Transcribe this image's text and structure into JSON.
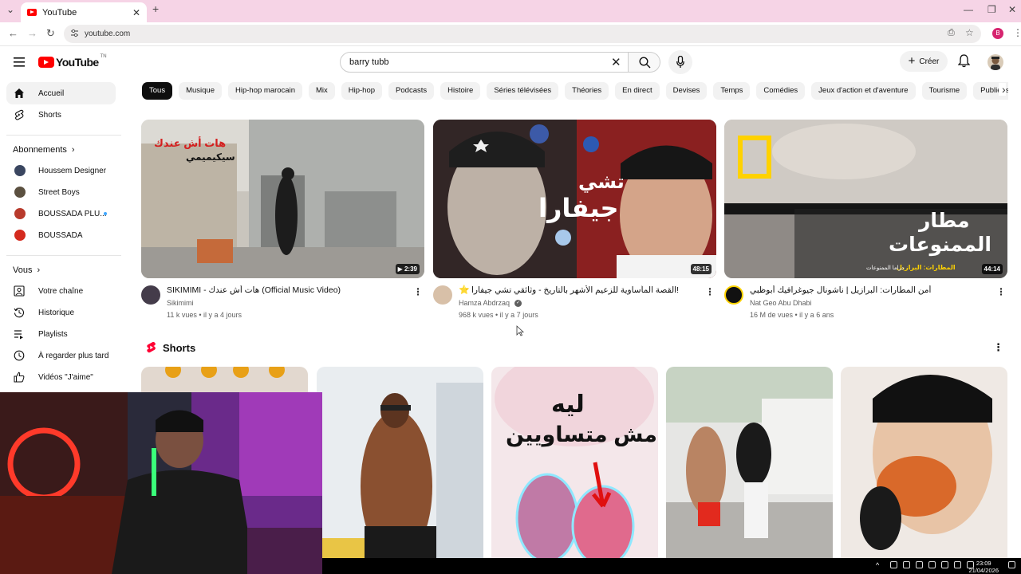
{
  "browser": {
    "tab_title": "YouTube",
    "url": "youtube.com",
    "profile_initial": "B",
    "colors": {
      "tabbar": "#f6d4e6",
      "profile": "#d6246f"
    }
  },
  "masthead": {
    "logo_text": "YouTube",
    "country_code": "TN",
    "search_value": "barry tubb",
    "create_label": "Créer"
  },
  "sidebar": {
    "main": [
      {
        "label": "Accueil",
        "icon": "home-icon",
        "active": true
      },
      {
        "label": "Shorts",
        "icon": "shorts-icon",
        "active": false
      }
    ],
    "subscriptions_header": "Abonnements",
    "subscriptions": [
      {
        "label": "Houssem Designer",
        "color": "#3a4660"
      },
      {
        "label": "Street Boys",
        "color": "#5b5040"
      },
      {
        "label": "BOUSSADA PLU...",
        "color": "#b83a2c",
        "live_dot": true
      },
      {
        "label": "BOUSSADA",
        "color": "#d42a1e"
      }
    ],
    "you_header": "Vous",
    "you": [
      {
        "label": "Votre chaîne",
        "icon": "channel-icon"
      },
      {
        "label": "Historique",
        "icon": "history-icon"
      },
      {
        "label": "Playlists",
        "icon": "playlist-icon"
      },
      {
        "label": "À regarder plus tard",
        "icon": "watch-later-icon"
      },
      {
        "label": "Vidéos \"J'aime\"",
        "icon": "like-icon"
      }
    ]
  },
  "chips": [
    "Tous",
    "Musique",
    "Hip-hop marocain",
    "Mix",
    "Hip-hop",
    "Podcasts",
    "Histoire",
    "Séries télévisées",
    "Théories",
    "En direct",
    "Devises",
    "Temps",
    "Comédies",
    "Jeux d'action et d'aventure",
    "Tourisme",
    "Publiées réc"
  ],
  "videos": [
    {
      "title": "SIKIMIMI - هات أش عندك (Official Music Video)",
      "channel": "Sikimimi",
      "meta": "11 k vues • il y a 4 jours",
      "duration": "2:39",
      "thumb_text": [
        "هات أش عندك",
        "سيكيميمي"
      ],
      "verified": false
    },
    {
      "title": "القصة المأساوية للزعيم الأشهر بالتاريخ - وثائقي تشي جيفارا!",
      "channel": "Hamza Abdrzaq",
      "meta": "968 k vues • il y a 7 jours",
      "duration": "48:15",
      "thumb_text": [
        "تشي",
        "جيفارا"
      ],
      "verified": true
    },
    {
      "title": "أمن المطارات: البرازيل | ناشونال جيوغرافيك أبوظبي",
      "channel": "Nat Geo Abu Dhabi",
      "meta": "16 M de vues • il y a 6 ans",
      "duration": "44:14",
      "thumb_text": [
        "مطار",
        "الممنوعات",
        "المطارات: البرازيل",
        "دراما الممنوعات"
      ],
      "verified": false
    }
  ],
  "shorts": {
    "header": "Shorts",
    "cards": [
      {
        "text": []
      },
      {
        "text": []
      },
      {
        "text": [
          "ليه",
          "مش متساويين"
        ]
      },
      {
        "text": []
      },
      {
        "text": []
      }
    ]
  },
  "taskbar": {
    "time": "23:09",
    "date": "21/04/2026"
  }
}
